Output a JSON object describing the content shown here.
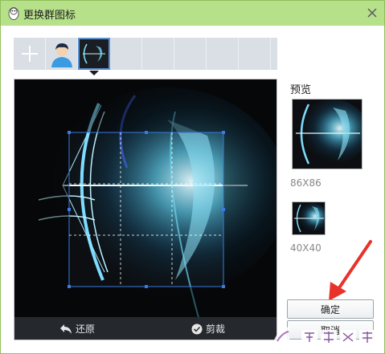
{
  "window": {
    "title": "更换群图标"
  },
  "editor": {
    "restore_label": "还原",
    "crop_label": "剪裁"
  },
  "preview": {
    "label": "预览",
    "big_size": "86X86",
    "small_size": "40X40"
  },
  "actions": {
    "ok_label": "确定",
    "cancel_label": "取消"
  },
  "icons": {
    "title": "qq-penguin-icon",
    "close": "close-icon",
    "add": "plus-icon",
    "avatar": "person-avatar-icon",
    "restore": "undo-arrow-icon",
    "crop": "check-circle-icon"
  },
  "colors": {
    "titlebar": "#b7e08a",
    "annotation_arrow": "#e8332a"
  },
  "watermark": {
    "text": "系统之家"
  }
}
